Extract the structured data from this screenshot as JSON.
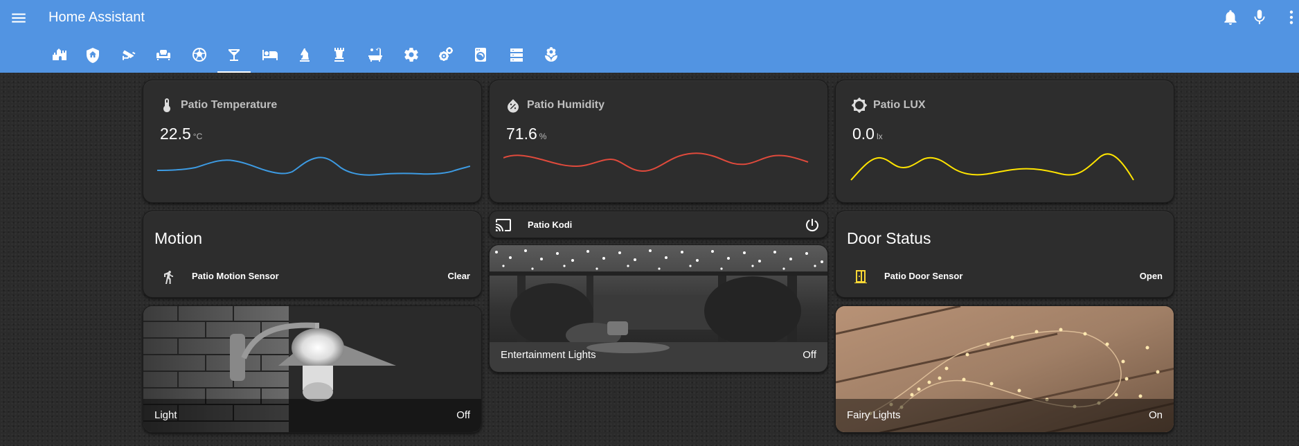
{
  "header": {
    "title": "Home Assistant",
    "icons": [
      "menu-icon",
      "bell-icon",
      "microphone-icon",
      "dots-vertical-icon"
    ],
    "accent_color": "#5294e2"
  },
  "tabs": [
    {
      "icon": "castle-icon"
    },
    {
      "icon": "shield-home-icon"
    },
    {
      "icon": "cctv-icon"
    },
    {
      "icon": "sofa-icon"
    },
    {
      "icon": "soccer-ball-icon"
    },
    {
      "icon": "glass-cocktail-icon",
      "active": true
    },
    {
      "icon": "bed-icon"
    },
    {
      "icon": "chess-knight-icon"
    },
    {
      "icon": "chess-rook-icon"
    },
    {
      "icon": "bathtub-icon"
    },
    {
      "icon": "settings-icon"
    },
    {
      "icon": "settings-multiple-icon"
    },
    {
      "icon": "washing-machine-icon"
    },
    {
      "icon": "server-icon"
    },
    {
      "icon": "flower-icon"
    }
  ],
  "sensors": {
    "temperature": {
      "name": "Patio Temperature",
      "value": "22.5",
      "unit": "°C",
      "icon": "thermometer-icon",
      "color": "#3d9be3"
    },
    "humidity": {
      "name": "Patio Humidity",
      "value": "71.6",
      "unit": "%",
      "icon": "water-percent-icon",
      "color": "#e04a3c"
    },
    "lux": {
      "name": "Patio LUX",
      "value": "0.0",
      "unit": "lx",
      "icon": "brightness-icon",
      "color": "#ffe400"
    }
  },
  "motion": {
    "title": "Motion",
    "entity_name": "Patio Motion Sensor",
    "state": "Clear",
    "icon": "walk-icon"
  },
  "kodi": {
    "name": "Patio Kodi",
    "icons": [
      "cast-icon",
      "power-icon"
    ]
  },
  "door": {
    "title": "Door Status",
    "entity_name": "Patio Door Sensor",
    "state": "Open",
    "icon": "door-open-icon",
    "icon_color": "#fdd835"
  },
  "pictures": {
    "light": {
      "name": "Light",
      "state": "Off"
    },
    "entertainment": {
      "name": "Entertainment Lights",
      "state": "Off"
    },
    "fairy": {
      "name": "Fairy Lights",
      "state": "On"
    }
  }
}
